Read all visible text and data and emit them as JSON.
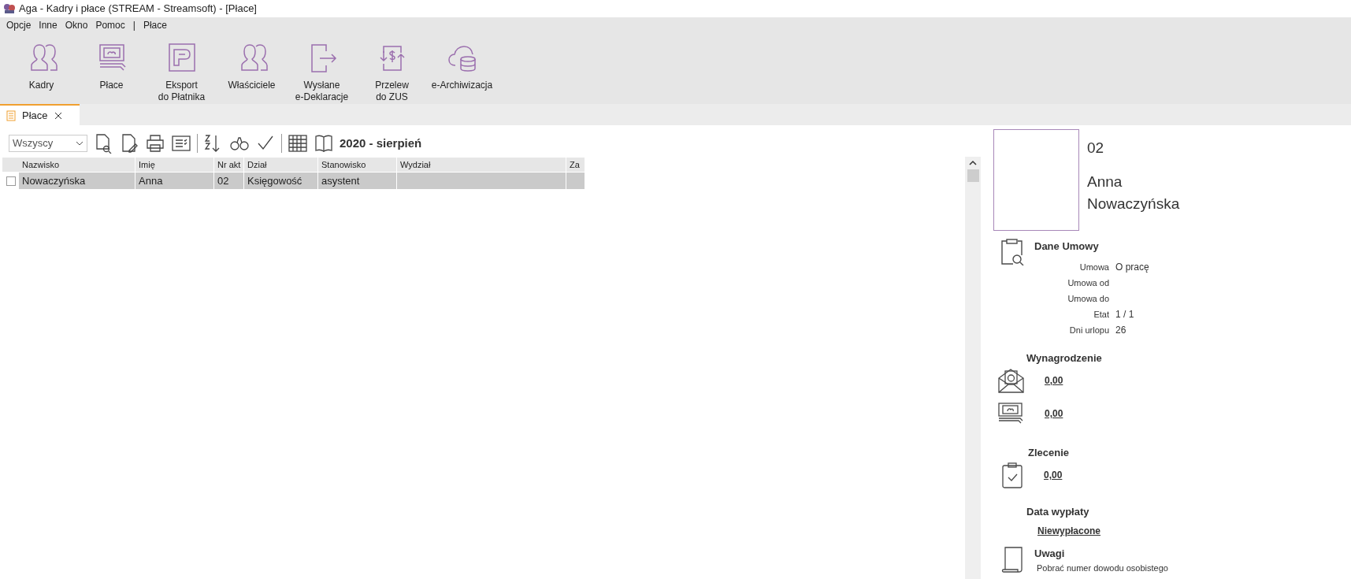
{
  "window": {
    "title": "Aga - Kadry i płace (STREAM - Streamsoft) - [Płace]"
  },
  "menu": [
    "Opcje",
    "Inne",
    "Okno",
    "Pomoc",
    "|",
    "Płace"
  ],
  "ribbon": [
    {
      "kind": "people",
      "label": "Kadry"
    },
    {
      "kind": "money",
      "label": "Płace"
    },
    {
      "kind": "p",
      "label": "Eksport\ndo Płatnika"
    },
    {
      "kind": "people",
      "label": "Właściciele"
    },
    {
      "kind": "exit",
      "label": "Wysłane\ne-Deklaracje"
    },
    {
      "kind": "transfer",
      "label": "Przelew\ndo ZUS"
    },
    {
      "kind": "cloud",
      "label": "e-Archiwizacja"
    }
  ],
  "doc_tabs": [
    {
      "label": "Płace",
      "selected": true
    }
  ],
  "filter": {
    "value": "Wszyscy"
  },
  "period": "2020 - sierpień",
  "table": {
    "columns": [
      "Nazwisko",
      "Imię",
      "Nr akt",
      "Dział",
      "Stanowisko",
      "Wydział",
      "Za"
    ],
    "rows": [
      {
        "selected": true,
        "checked": false,
        "cells": [
          "Nowaczyńska",
          "Anna",
          "02",
          "Księgowość",
          "asystent",
          "",
          ""
        ]
      }
    ]
  },
  "details": {
    "number": "02",
    "first_name": "Anna",
    "last_name": "Nowaczyńska",
    "contract": {
      "title": "Dane Umowy",
      "fields": [
        {
          "label": "Umowa",
          "value": "O pracę"
        },
        {
          "label": "Umowa od"
        },
        {
          "label": "Umowa do"
        },
        {
          "label": "Etat",
          "value": "1 / 1"
        },
        {
          "label": "Dni urlopu",
          "value": "26"
        }
      ]
    },
    "salary": {
      "title": "Wynagrodzenie",
      "gross": "0,00",
      "net": "0,00"
    },
    "order": {
      "title": "Zlecenie",
      "amount": "0,00"
    },
    "payout": {
      "title": "Data wypłaty",
      "value": "Niewypłacone"
    },
    "notes": {
      "title": "Uwagi",
      "text": "Pobrać numer dowodu osobistego"
    }
  }
}
